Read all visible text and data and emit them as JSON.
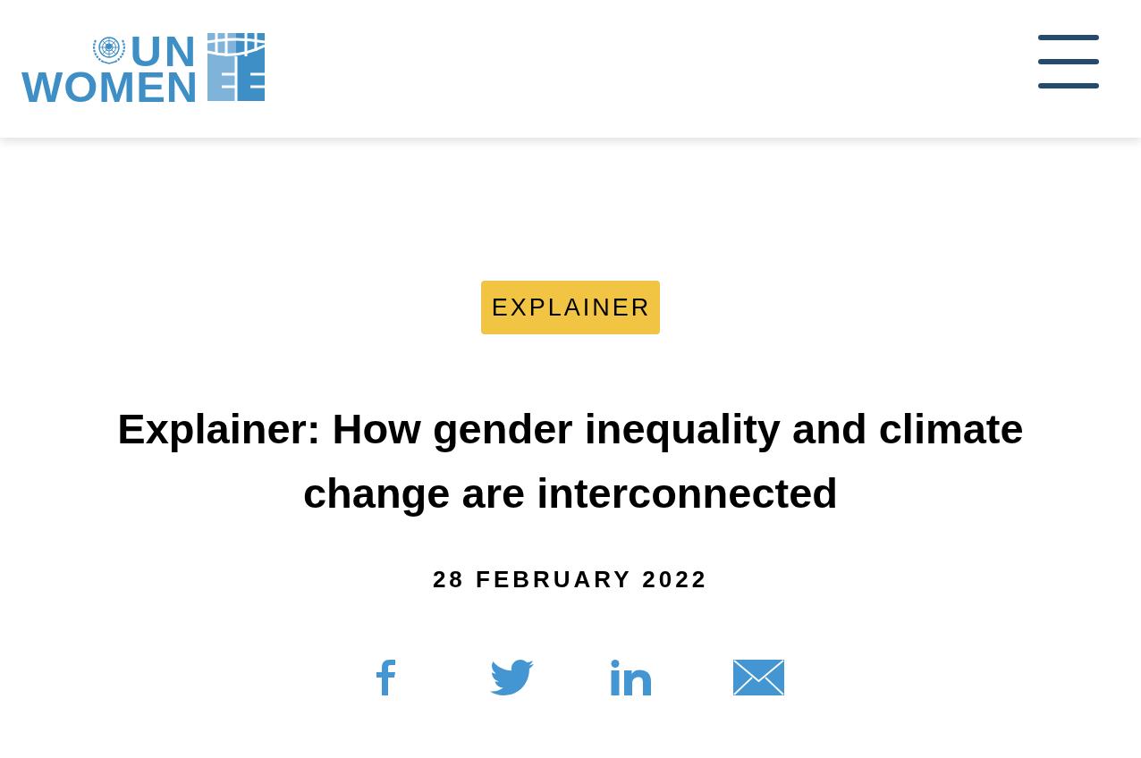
{
  "header": {
    "logo": {
      "line_1": "UN",
      "line_2": "WOMEN"
    }
  },
  "article": {
    "tag": "EXPLAINER",
    "title": "Explainer: How gender inequality and climate change are interconnected",
    "date": "28 FEBRUARY 2022"
  }
}
